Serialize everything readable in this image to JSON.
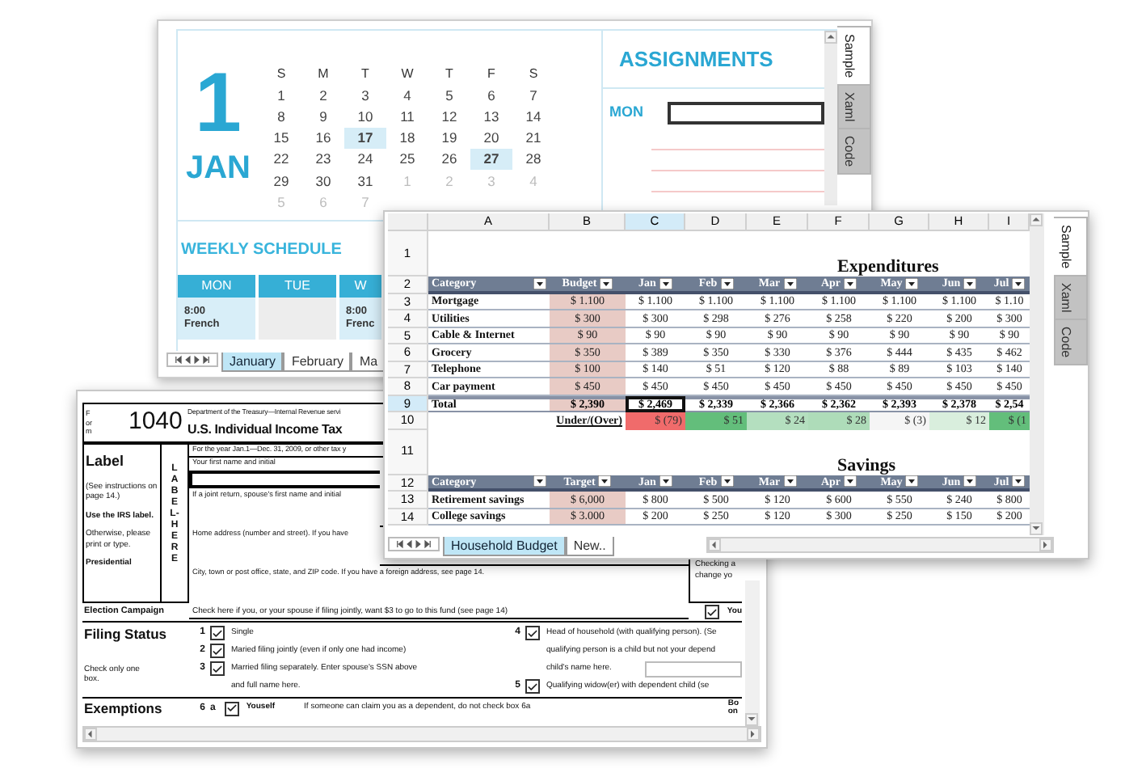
{
  "calendar_window": {
    "side_tabs": [
      {
        "label": "Sample",
        "selected": true
      },
      {
        "label": "Xaml",
        "selected": false
      },
      {
        "label": "Code",
        "selected": false
      }
    ],
    "day_number": "1",
    "month": "JAN",
    "weekdays": [
      "S",
      "M",
      "T",
      "W",
      "T",
      "F",
      "S"
    ],
    "days": [
      {
        "label": "1",
        "muted": false,
        "selected": false
      },
      {
        "label": "2",
        "muted": false,
        "selected": false
      },
      {
        "label": "3",
        "muted": false,
        "selected": false
      },
      {
        "label": "4",
        "muted": false,
        "selected": false
      },
      {
        "label": "5",
        "muted": false,
        "selected": false
      },
      {
        "label": "6",
        "muted": false,
        "selected": false
      },
      {
        "label": "7",
        "muted": false,
        "selected": false
      },
      {
        "label": "8",
        "muted": false,
        "selected": false
      },
      {
        "label": "9",
        "muted": false,
        "selected": false
      },
      {
        "label": "10",
        "muted": false,
        "selected": false
      },
      {
        "label": "11",
        "muted": false,
        "selected": false
      },
      {
        "label": "12",
        "muted": false,
        "selected": false
      },
      {
        "label": "13",
        "muted": false,
        "selected": false
      },
      {
        "label": "14",
        "muted": false,
        "selected": false
      },
      {
        "label": "15",
        "muted": false,
        "selected": false
      },
      {
        "label": "16",
        "muted": false,
        "selected": false
      },
      {
        "label": "17",
        "muted": false,
        "selected": true
      },
      {
        "label": "18",
        "muted": false,
        "selected": false
      },
      {
        "label": "19",
        "muted": false,
        "selected": false
      },
      {
        "label": "20",
        "muted": false,
        "selected": false
      },
      {
        "label": "21",
        "muted": false,
        "selected": false
      },
      {
        "label": "22",
        "muted": false,
        "selected": false
      },
      {
        "label": "23",
        "muted": false,
        "selected": false
      },
      {
        "label": "24",
        "muted": false,
        "selected": false
      },
      {
        "label": "25",
        "muted": false,
        "selected": false
      },
      {
        "label": "26",
        "muted": false,
        "selected": false
      },
      {
        "label": "27",
        "muted": false,
        "selected": true
      },
      {
        "label": "28",
        "muted": false,
        "selected": false
      },
      {
        "label": "29",
        "muted": false,
        "selected": false
      },
      {
        "label": "30",
        "muted": false,
        "selected": false
      },
      {
        "label": "31",
        "muted": false,
        "selected": false
      },
      {
        "label": "1",
        "muted": true,
        "selected": false
      },
      {
        "label": "2",
        "muted": true,
        "selected": false
      },
      {
        "label": "3",
        "muted": true,
        "selected": false
      },
      {
        "label": "4",
        "muted": true,
        "selected": false
      },
      {
        "label": "5",
        "muted": true,
        "selected": false
      },
      {
        "label": "6",
        "muted": true,
        "selected": false
      },
      {
        "label": "7",
        "muted": true,
        "selected": false
      }
    ],
    "weekly_schedule": {
      "title": "WEEKLY SCHEDULE",
      "columns": [
        {
          "label": "MON",
          "entry": [
            "8:00",
            "French"
          ]
        },
        {
          "label": "TUE"
        },
        {
          "label": "W",
          "entry": [
            "8:00",
            "Frenc"
          ]
        }
      ]
    },
    "assignments": {
      "title": "ASSIGNMENTS",
      "day": "MON"
    },
    "sheet_tabs": [
      {
        "label": "January",
        "selected": true
      },
      {
        "label": "February",
        "selected": false
      },
      {
        "label": "Ma",
        "selected": false
      }
    ]
  },
  "spreadsheet_window": {
    "side_tabs": [
      {
        "label": "Sample",
        "selected": true
      },
      {
        "label": "Xaml",
        "selected": false
      },
      {
        "label": "Code",
        "selected": false
      }
    ],
    "columns": [
      {
        "label": "A",
        "selected": false
      },
      {
        "label": "B",
        "selected": false
      },
      {
        "label": "C",
        "selected": true
      },
      {
        "label": "D",
        "selected": false
      },
      {
        "label": "E",
        "selected": false
      },
      {
        "label": "F",
        "selected": false
      },
      {
        "label": "G",
        "selected": false
      },
      {
        "label": "H",
        "selected": false
      },
      {
        "label": "I",
        "selected": false
      }
    ],
    "rows": [
      {
        "number": "1",
        "kind": "title",
        "selected": false,
        "title": "Expenditures"
      },
      {
        "number": "2",
        "kind": "header",
        "selected": false,
        "cells": [
          "Category",
          "Budget",
          "Jan",
          "Feb",
          "Mar",
          "Apr",
          "May",
          "Jun",
          "Jul"
        ]
      },
      {
        "number": "3",
        "kind": "data",
        "selected": false,
        "cells": [
          "Mortgage",
          "$ 1.100",
          "$ 1.100",
          "$ 1.100",
          "$ 1.100",
          "$ 1.100",
          "$ 1.100",
          "$ 1.100",
          "$ 1.10"
        ]
      },
      {
        "number": "4",
        "kind": "data",
        "selected": false,
        "cells": [
          "Utilities",
          "$ 300",
          "$ 300",
          "$ 298",
          "$ 276",
          "$ 258",
          "$ 220",
          "$ 200",
          "$ 300"
        ]
      },
      {
        "number": "5",
        "kind": "data",
        "selected": false,
        "cells": [
          "Cable & Internet",
          "$ 90",
          "$ 90",
          "$ 90",
          "$ 90",
          "$ 90",
          "$ 90",
          "$ 90",
          "$ 90"
        ]
      },
      {
        "number": "6",
        "kind": "data",
        "selected": false,
        "cells": [
          "Grocery",
          "$ 350",
          "$ 389",
          "$ 350",
          "$ 330",
          "$ 376",
          "$ 444",
          "$ 435",
          "$ 462"
        ]
      },
      {
        "number": "7",
        "kind": "data",
        "selected": false,
        "cells": [
          "Telephone",
          "$ 100",
          "$ 140",
          "$ 51",
          "$ 120",
          "$ 88",
          "$ 89",
          "$ 103",
          "$ 140"
        ]
      },
      {
        "number": "8",
        "kind": "data",
        "selected": false,
        "cells": [
          "Car payment",
          "$ 450",
          "$ 450",
          "$ 450",
          "$ 450",
          "$ 450",
          "$ 450",
          "$ 450",
          "$ 450"
        ]
      },
      {
        "number": "9",
        "kind": "total",
        "selected": true,
        "cells": [
          {
            "text": "Total",
            "selected": false
          },
          {
            "text": "$ 2,390",
            "selected": false
          },
          {
            "text": "$ 2,469",
            "selected": true
          },
          {
            "text": "$ 2,339",
            "selected": false
          },
          {
            "text": "$ 2,366",
            "selected": false
          },
          {
            "text": "$ 2,362",
            "selected": false
          },
          {
            "text": "$ 2,393",
            "selected": false
          },
          {
            "text": "$ 2,378",
            "selected": false
          },
          {
            "text": "$ 2,54",
            "selected": false
          }
        ]
      },
      {
        "number": "10",
        "kind": "variance",
        "selected": false,
        "label": "Under/(Over)",
        "cells": [
          {
            "text": "$ (79)",
            "color": "#f06b6b"
          },
          {
            "text": "$ 51",
            "color": "#63be7b"
          },
          {
            "text": "$ 24",
            "color": "#b4dfbf"
          },
          {
            "text": "$ 28",
            "color": "#aedcb9"
          },
          {
            "text": "$ (3)",
            "color": "#f5f5f5"
          },
          {
            "text": "$ 12",
            "color": "#d9eedd"
          },
          {
            "text": "$ (1",
            "color": "#63be7b"
          }
        ]
      },
      {
        "number": "11",
        "kind": "title",
        "selected": false,
        "title": "Savings"
      },
      {
        "number": "12",
        "kind": "header",
        "selected": false,
        "cells": [
          "Category",
          "Target",
          "Jan",
          "Feb",
          "Mar",
          "Apr",
          "May",
          "Jun",
          "Jul"
        ]
      },
      {
        "number": "13",
        "kind": "data",
        "selected": false,
        "cells": [
          "Retirement savings",
          "$ 6,000",
          "$ 800",
          "$ 500",
          "$ 120",
          "$ 600",
          "$ 550",
          "$ 240",
          "$ 800"
        ]
      },
      {
        "number": "14",
        "kind": "data",
        "selected": false,
        "cells": [
          "College savings",
          "$ 3.000",
          "$ 200",
          "$ 250",
          "$ 120",
          "$ 300",
          "$ 250",
          "$ 150",
          "$ 200"
        ]
      }
    ],
    "sheet_tabs": [
      {
        "label": "Household Budget",
        "selected": true
      },
      {
        "label": "New..",
        "selected": false
      }
    ]
  },
  "form_window": {
    "form_label": "Form",
    "form_number": "1040",
    "department": "Department of the Treasury—Internal Revenue servi",
    "title": "U.S. Individual Income Tax",
    "label_panel": {
      "title": "Label",
      "notes": [
        {
          "text": "(See instructions on page 14.)",
          "kind": "note"
        },
        {
          "text": "Use the IRS label.",
          "kind": "emphasis"
        },
        {
          "text": "Otherwise, please print or type.",
          "kind": "note"
        },
        {
          "text": "Presidential",
          "kind": "emphasis"
        }
      ]
    },
    "label_here": "LABEL-HERE",
    "fields": [
      {
        "label": "For the year Jan.1—Dec. 31, 2009, or other tax y",
        "kind": "caption"
      },
      {
        "label": "Your first name and initial",
        "kind": "boxed"
      },
      {
        "label": "If a joint return, spouse's first name and initial",
        "kind": "line"
      },
      {
        "label": "Home address (number and street). If you have",
        "kind": "line"
      },
      {
        "label": "City, town or post office, state, and ZIP code. If you have a foreign address, see page 14.",
        "kind": "line"
      }
    ],
    "side_note": [
      "Checking a",
      "change yo"
    ],
    "election": {
      "title": "Election Campaign",
      "text": "Check here if you, or your spouse if filing jointly, want $3 to go to this fund (see page 14)",
      "checked": true,
      "option": "You"
    },
    "filing_status": {
      "title": "Filing Status",
      "hint": "Check only one box.",
      "left": [
        {
          "number": "1",
          "label": "Single",
          "checked": true,
          "has_field": false
        },
        {
          "number": "2",
          "label": "Maried filing jointly (even if only one had income)",
          "checked": true,
          "has_field": false
        },
        {
          "number": "3",
          "label": "Married filing separately. Enter spouse's SSN above",
          "checked": true,
          "continuation": [
            "and full name here."
          ],
          "has_field": false
        }
      ],
      "right": [
        {
          "number": "4",
          "label": "Head of household (with qualifying person). (Se",
          "checked": true,
          "continuation": [
            "qualifying person is a child but not your depend",
            "child's name here."
          ],
          "has_field": true
        },
        {
          "number": "5",
          "label": "Qualifying widow(er) with dependent child (se",
          "checked": true,
          "has_field": false
        }
      ]
    },
    "exemptions": {
      "title": "Exemptions",
      "number": "6",
      "letter": "a",
      "option": "Youself",
      "checked": true,
      "note": "If someone can claim you as a dependent, do not check box 6a",
      "side": [
        "Bo",
        "on"
      ]
    }
  }
}
